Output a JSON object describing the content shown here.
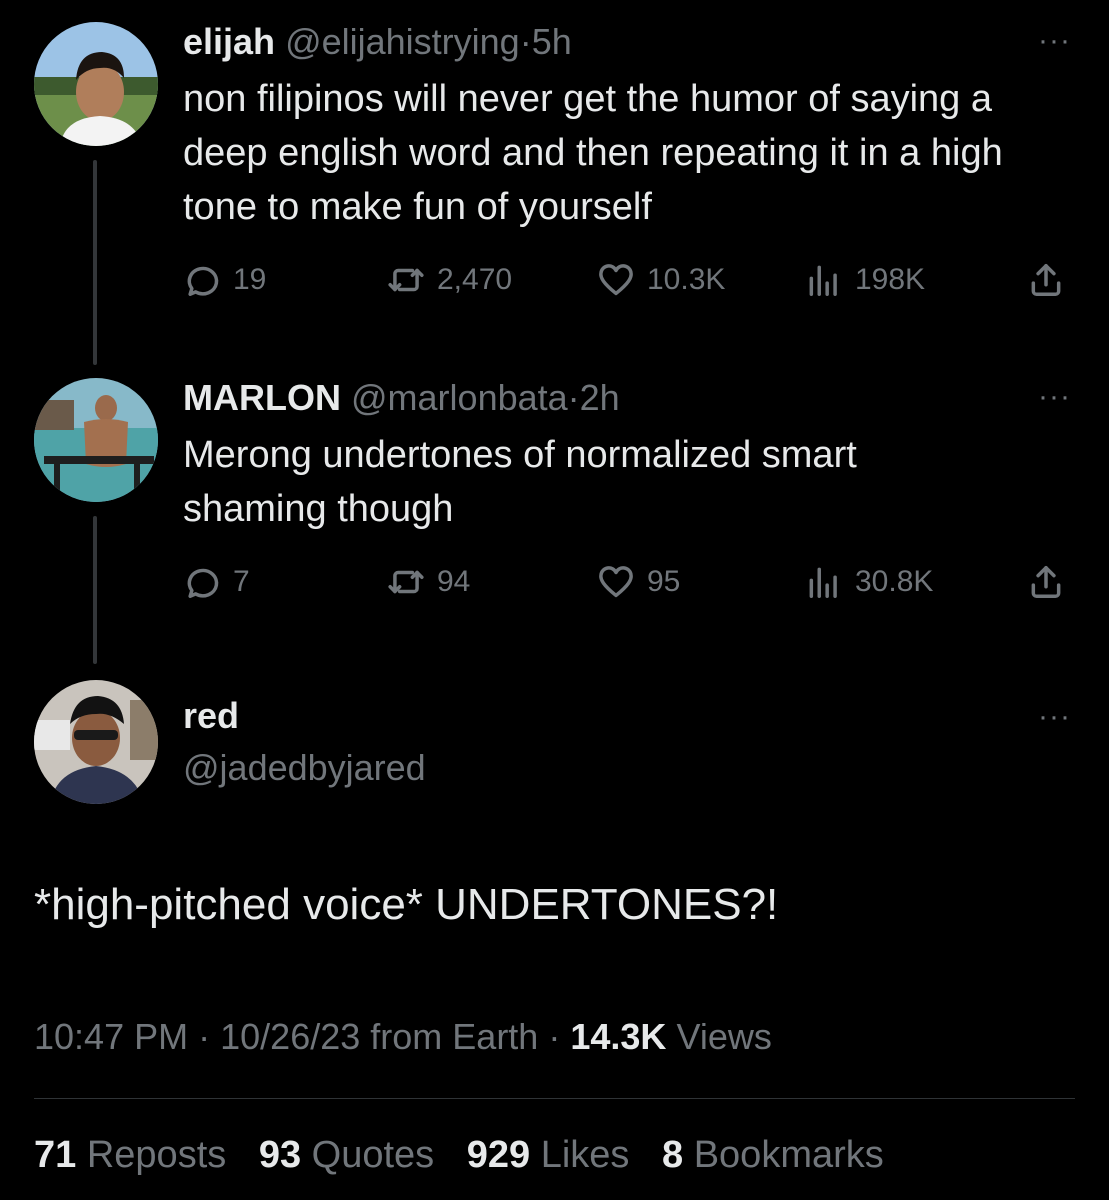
{
  "tweets": [
    {
      "name": "elijah",
      "handle": "@elijahistrying",
      "separator": "·",
      "time": "5h",
      "more": "···",
      "text": "non filipinos will never get the humor of saying a deep english word and then repeating it in a high tone to make fun of yourself",
      "replies": "19",
      "reposts": "2,470",
      "likes": "10.3K",
      "views": "198K"
    },
    {
      "name": "MARLON",
      "handle": "@marlonbata",
      "separator": "·",
      "time": "2h",
      "more": "···",
      "text": "Merong undertones of normalized smart shaming though",
      "replies": "7",
      "reposts": "94",
      "likes": "95",
      "views": "30.8K"
    }
  ],
  "main": {
    "name": "red",
    "handle": "@jadedbyjared",
    "more": "···",
    "text": "*high-pitched voice* UNDERTONES?!",
    "time": "10:47 PM",
    "date": "10/26/23",
    "source": "from Earth",
    "separator": "·",
    "views_count": "14.3K",
    "views_label": "Views",
    "reposts_count": "71",
    "reposts_label": "Reposts",
    "quotes_count": "93",
    "quotes_label": "Quotes",
    "likes_count": "929",
    "likes_label": "Likes",
    "bookmarks_count": "8",
    "bookmarks_label": "Bookmarks"
  },
  "icons": {
    "reply": "reply-icon",
    "repost": "repost-icon",
    "like": "heart-icon",
    "views": "views-icon",
    "share": "share-icon"
  },
  "colors": {
    "background": "#000000",
    "text_primary": "#e7e9ea",
    "text_secondary": "#71767b",
    "divider": "#2f3336"
  }
}
